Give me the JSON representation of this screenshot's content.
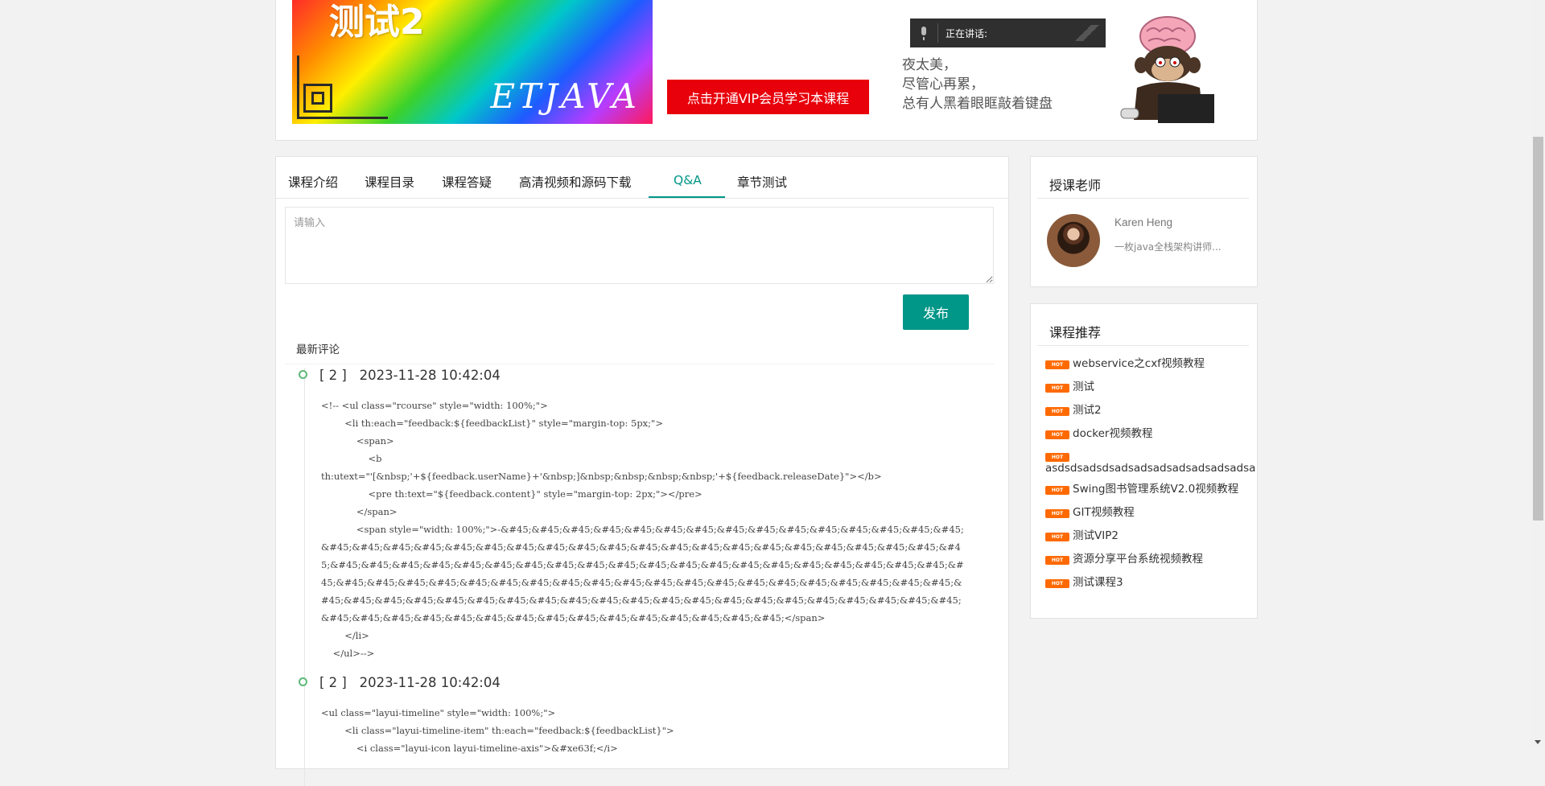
{
  "banner": {
    "course_title": "测试2",
    "brand": "ETJAVA",
    "vip_button": "点击开通VIP会员学习本课程",
    "voice_status": "正在讲话:",
    "poem": [
      "夜太美，",
      "尽管心再累，",
      "总有人黑着眼眶敲着键盘"
    ]
  },
  "tabs": [
    {
      "label": "课程介绍",
      "active": false
    },
    {
      "label": "课程目录",
      "active": false
    },
    {
      "label": "课程答疑",
      "active": false
    },
    {
      "label": "高清视频和源码下载",
      "active": false
    },
    {
      "label": "Q&A",
      "active": true
    },
    {
      "label": "章节测试",
      "active": false
    }
  ],
  "comment": {
    "placeholder": "请输入",
    "value": "",
    "publish_label": "发布",
    "latest_label": "最新评论"
  },
  "feedback": [
    {
      "user": "[ 2 ]",
      "time": "2023-11-28 10:42:04",
      "content": "<!-- <ul class=\"rcourse\" style=\"width: 100%;\">\n        <li th:each=\"feedback:${feedbackList}\" style=\"margin-top: 5px;\">\n            <span>\n                <b\nth:utext=\"'[&nbsp;'+${feedback.userName}+'&nbsp;]&nbsp;&nbsp;&nbsp;&nbsp;'+${feedback.releaseDate}\"></b>\n                <pre th:text=\"${feedback.content}\" style=\"margin-top: 2px;\"></pre>\n            </span>\n            <span style=\"width: 100%;\">-&#45;&#45;&#45;&#45;&#45;&#45;&#45;&#45;&#45;&#45;&#45;&#45;&#45;&#45;&#45;&#45;&#45;&#45;&#45;&#45;&#45;&#45;&#45;&#45;&#45;&#45;&#45;&#45;&#45;&#45;&#45;&#45;&#45;&#45;&#45;&#45;&#45;&#45;&#45;&#45;&#45;&#45;&#45;&#45;&#45;&#45;&#45;&#45;&#45;&#45;&#45;&#45;&#45;&#45;&#45;&#45;&#45;&#45;&#45;&#45;&#45;&#45;&#45;&#45;&#45;&#45;&#45;&#45;&#45;&#45;&#45;&#45;&#45;&#45;&#45;&#45;&#45;&#45;&#45;&#45;&#45;&#45;&#45;&#45;&#45;&#45;&#45;&#45;&#45;&#45;&#45;&#45;&#45;&#45;&#45;&#45;&#45;&#45;&#45;&#45;&#45;&#45;&#45;&#45;&#45;&#45;&#45;&#45;&#45;&#45;&#45;&#45;&#45;</span>\n        </li>\n    </ul>-->"
    },
    {
      "user": "[ 2 ]",
      "time": "2023-11-28 10:42:04",
      "content": "<ul class=\"layui-timeline\" style=\"width: 100%;\">\n        <li class=\"layui-timeline-item\" th:each=\"feedback:${feedbackList}\">\n            <i class=\"layui-icon layui-timeline-axis\">&#xe63f;</i>"
    }
  ],
  "teacher": {
    "section_title": "授课老师",
    "name": "Karen Heng",
    "description": "一枚java全栈架构讲师..."
  },
  "recommend": {
    "section_title": "课程推荐",
    "badge": "HOT",
    "items": [
      "webservice之cxf视频教程",
      "测试",
      "测试2",
      "docker视频教程",
      "asdsdsadsdsadsadsadsadsadsadsadsa",
      "Swing图书管理系统V2.0视频教程",
      "GIT视频教程",
      "测试VIP2",
      "资源分享平台系统视频教程",
      "测试课程3"
    ]
  },
  "colors": {
    "accent": "#009688",
    "vip_red": "#e8000b",
    "hot_badge": "#ff6a00"
  }
}
